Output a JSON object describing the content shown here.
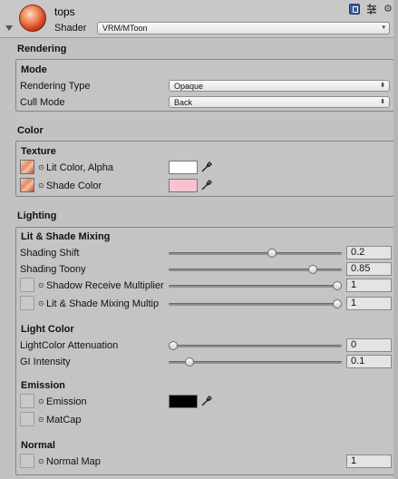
{
  "header": {
    "title": "tops",
    "shader_label": "Shader",
    "shader_value": "VRM/MToon"
  },
  "rendering": {
    "section_title": "Rendering",
    "mode_title": "Mode",
    "rendering_type_label": "Rendering Type",
    "rendering_type_value": "Opaque",
    "cull_mode_label": "Cull Mode",
    "cull_mode_value": "Back"
  },
  "color": {
    "section_title": "Color",
    "texture_title": "Texture",
    "lit_color_label": "Lit Color, Alpha",
    "lit_color_swatch": "#ffffff",
    "shade_color_label": "Shade Color",
    "shade_color_swatch": "#f6c3d0"
  },
  "lighting": {
    "section_title": "Lighting",
    "mixing_title": "Lit & Shade Mixing",
    "shading_shift_label": "Shading Shift",
    "shading_shift_value": "0.2",
    "shading_shift_fraction": 0.6,
    "shading_toony_label": "Shading Toony",
    "shading_toony_value": "0.85",
    "shading_toony_fraction": 0.85,
    "shadow_receive_label": "Shadow Receive Multiplier",
    "shadow_receive_value": "1",
    "shadow_receive_fraction": 1,
    "mixing_multiplier_label": "Lit & Shade Mixing Multip",
    "mixing_multiplier_value": "1",
    "mixing_multiplier_fraction": 1,
    "light_color_title": "Light Color",
    "attenuation_label": "LightColor Attenuation",
    "attenuation_value": "0",
    "attenuation_fraction": 0,
    "gi_label": "GI Intensity",
    "gi_value": "0.1",
    "gi_fraction": 0.1,
    "emission_title": "Emission",
    "emission_label": "Emission",
    "emission_swatch": "#000000",
    "matcap_label": "MatCap",
    "normal_title": "Normal",
    "normal_map_label": "Normal Map",
    "normal_map_value": "1"
  },
  "dot_glyph": "⊙",
  "dropdown_arrow": "▾",
  "gear_glyph": "⚙"
}
